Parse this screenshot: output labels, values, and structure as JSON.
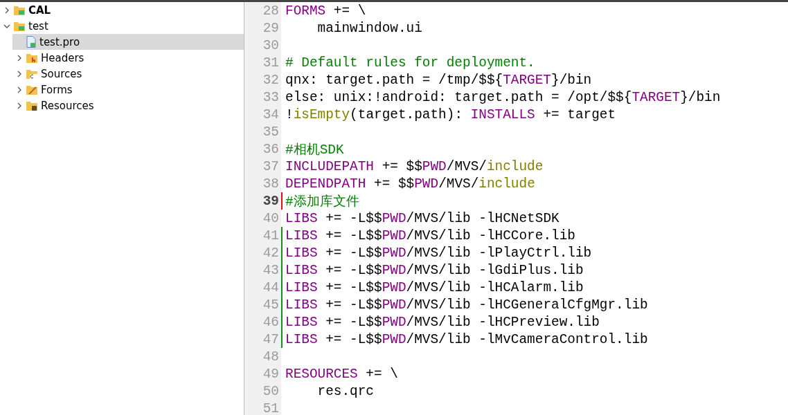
{
  "project_tree": {
    "items": [
      {
        "label": "CAL",
        "kind": "project",
        "active": true,
        "expanded": false,
        "selected": false
      },
      {
        "label": "test",
        "kind": "project",
        "active": false,
        "expanded": true,
        "selected": false,
        "children": [
          {
            "label": "test.pro",
            "kind": "pro-file",
            "active": false,
            "selected": true
          },
          {
            "label": "Headers",
            "kind": "headers-folder",
            "active": false,
            "expanded": false,
            "selected": false
          },
          {
            "label": "Sources",
            "kind": "sources-folder",
            "active": false,
            "expanded": false,
            "selected": false
          },
          {
            "label": "Forms",
            "kind": "forms-folder",
            "active": false,
            "expanded": false,
            "selected": false
          },
          {
            "label": "Resources",
            "kind": "resources-folder",
            "active": false,
            "expanded": false,
            "selected": false
          }
        ]
      }
    ]
  },
  "editor": {
    "lines": [
      {
        "number": "28",
        "current": false,
        "modified": false,
        "added": false,
        "tokens": [
          {
            "kind": "keyword",
            "text": "FORMS"
          },
          {
            "kind": "plain",
            "text": " += \\"
          }
        ]
      },
      {
        "number": "29",
        "current": false,
        "modified": false,
        "added": false,
        "tokens": [
          {
            "kind": "plain",
            "text": "    mainwindow.ui"
          }
        ]
      },
      {
        "number": "30",
        "current": false,
        "modified": false,
        "added": false
      },
      {
        "number": "31",
        "current": false,
        "modified": false,
        "added": false,
        "tokens": [
          {
            "kind": "comment",
            "text": "# Default rules for deployment."
          }
        ]
      },
      {
        "number": "32",
        "current": false,
        "modified": false,
        "added": false,
        "tokens": [
          {
            "kind": "plain",
            "text": "qnx: target.path = /tmp/$${"
          },
          {
            "kind": "keyword",
            "text": "TARGET"
          },
          {
            "kind": "plain",
            "text": "}/bin"
          }
        ]
      },
      {
        "number": "33",
        "current": false,
        "modified": false,
        "added": false,
        "tokens": [
          {
            "kind": "plain",
            "text": "else: unix:!android: target.path = /opt/$${"
          },
          {
            "kind": "keyword",
            "text": "TARGET"
          },
          {
            "kind": "plain",
            "text": "}/bin"
          }
        ]
      },
      {
        "number": "34",
        "current": false,
        "modified": false,
        "added": false,
        "tokens": [
          {
            "kind": "plain",
            "text": "!"
          },
          {
            "kind": "function",
            "text": "isEmpty"
          },
          {
            "kind": "plain",
            "text": "(target.path): "
          },
          {
            "kind": "keyword",
            "text": "INSTALLS"
          },
          {
            "kind": "plain",
            "text": " += target"
          }
        ]
      },
      {
        "number": "35",
        "current": false,
        "modified": false,
        "added": false
      },
      {
        "number": "36",
        "current": false,
        "modified": false,
        "added": false,
        "tokens": [
          {
            "kind": "comment",
            "text": "#相机SDK"
          }
        ]
      },
      {
        "number": "37",
        "current": false,
        "modified": false,
        "added": false,
        "tokens": [
          {
            "kind": "keyword",
            "text": "INCLUDEPATH"
          },
          {
            "kind": "plain",
            "text": " += $$"
          },
          {
            "kind": "keyword",
            "text": "PWD"
          },
          {
            "kind": "plain",
            "text": "/MVS/"
          },
          {
            "kind": "function",
            "text": "include"
          }
        ]
      },
      {
        "number": "38",
        "current": false,
        "modified": false,
        "added": false,
        "tokens": [
          {
            "kind": "keyword",
            "text": "DEPENDPATH"
          },
          {
            "kind": "plain",
            "text": " += $$"
          },
          {
            "kind": "keyword",
            "text": "PWD"
          },
          {
            "kind": "plain",
            "text": "/MVS/"
          },
          {
            "kind": "function",
            "text": "include"
          }
        ]
      },
      {
        "number": "39",
        "current": true,
        "modified": true,
        "added": false,
        "tokens": [
          {
            "kind": "comment",
            "text": "#添加库文件"
          }
        ]
      },
      {
        "number": "40",
        "current": false,
        "modified": false,
        "added": false,
        "tokens": [
          {
            "kind": "keyword",
            "text": "LIBS"
          },
          {
            "kind": "plain",
            "text": " += -L$$"
          },
          {
            "kind": "keyword",
            "text": "PWD"
          },
          {
            "kind": "plain",
            "text": "/MVS/lib -lHCNetSDK"
          }
        ]
      },
      {
        "number": "41",
        "current": false,
        "modified": false,
        "added": true,
        "tokens": [
          {
            "kind": "keyword",
            "text": "LIBS"
          },
          {
            "kind": "plain",
            "text": " += -L$$"
          },
          {
            "kind": "keyword",
            "text": "PWD"
          },
          {
            "kind": "plain",
            "text": "/MVS/lib -lHCCore.lib"
          }
        ]
      },
      {
        "number": "42",
        "current": false,
        "modified": false,
        "added": true,
        "tokens": [
          {
            "kind": "keyword",
            "text": "LIBS"
          },
          {
            "kind": "plain",
            "text": " += -L$$"
          },
          {
            "kind": "keyword",
            "text": "PWD"
          },
          {
            "kind": "plain",
            "text": "/MVS/lib -lPlayCtrl.lib"
          }
        ]
      },
      {
        "number": "43",
        "current": false,
        "modified": false,
        "added": true,
        "tokens": [
          {
            "kind": "keyword",
            "text": "LIBS"
          },
          {
            "kind": "plain",
            "text": " += -L$$"
          },
          {
            "kind": "keyword",
            "text": "PWD"
          },
          {
            "kind": "plain",
            "text": "/MVS/lib -lGdiPlus.lib"
          }
        ]
      },
      {
        "number": "44",
        "current": false,
        "modified": false,
        "added": true,
        "tokens": [
          {
            "kind": "keyword",
            "text": "LIBS"
          },
          {
            "kind": "plain",
            "text": " += -L$$"
          },
          {
            "kind": "keyword",
            "text": "PWD"
          },
          {
            "kind": "plain",
            "text": "/MVS/lib -lHCAlarm.lib"
          }
        ]
      },
      {
        "number": "45",
        "current": false,
        "modified": false,
        "added": true,
        "tokens": [
          {
            "kind": "keyword",
            "text": "LIBS"
          },
          {
            "kind": "plain",
            "text": " += -L$$"
          },
          {
            "kind": "keyword",
            "text": "PWD"
          },
          {
            "kind": "plain",
            "text": "/MVS/lib -lHCGeneralCfgMgr.lib"
          }
        ]
      },
      {
        "number": "46",
        "current": false,
        "modified": false,
        "added": true,
        "tokens": [
          {
            "kind": "keyword",
            "text": "LIBS"
          },
          {
            "kind": "plain",
            "text": " += -L$$"
          },
          {
            "kind": "keyword",
            "text": "PWD"
          },
          {
            "kind": "plain",
            "text": "/MVS/lib -lHCPreview.lib"
          }
        ]
      },
      {
        "number": "47",
        "current": false,
        "modified": false,
        "added": true,
        "tokens": [
          {
            "kind": "keyword",
            "text": "LIBS"
          },
          {
            "kind": "plain",
            "text": " += -L$$"
          },
          {
            "kind": "keyword",
            "text": "PWD"
          },
          {
            "kind": "plain",
            "text": "/MVS/lib -lMvCameraControl.lib"
          }
        ]
      },
      {
        "number": "48",
        "current": false,
        "modified": false,
        "added": false
      },
      {
        "number": "49",
        "current": false,
        "modified": false,
        "added": false,
        "tokens": [
          {
            "kind": "keyword",
            "text": "RESOURCES"
          },
          {
            "kind": "plain",
            "text": " += \\"
          }
        ]
      },
      {
        "number": "50",
        "current": false,
        "modified": false,
        "added": false,
        "tokens": [
          {
            "kind": "plain",
            "text": "    res.qrc"
          }
        ]
      },
      {
        "number": "51",
        "current": false,
        "modified": false,
        "added": false
      }
    ]
  }
}
